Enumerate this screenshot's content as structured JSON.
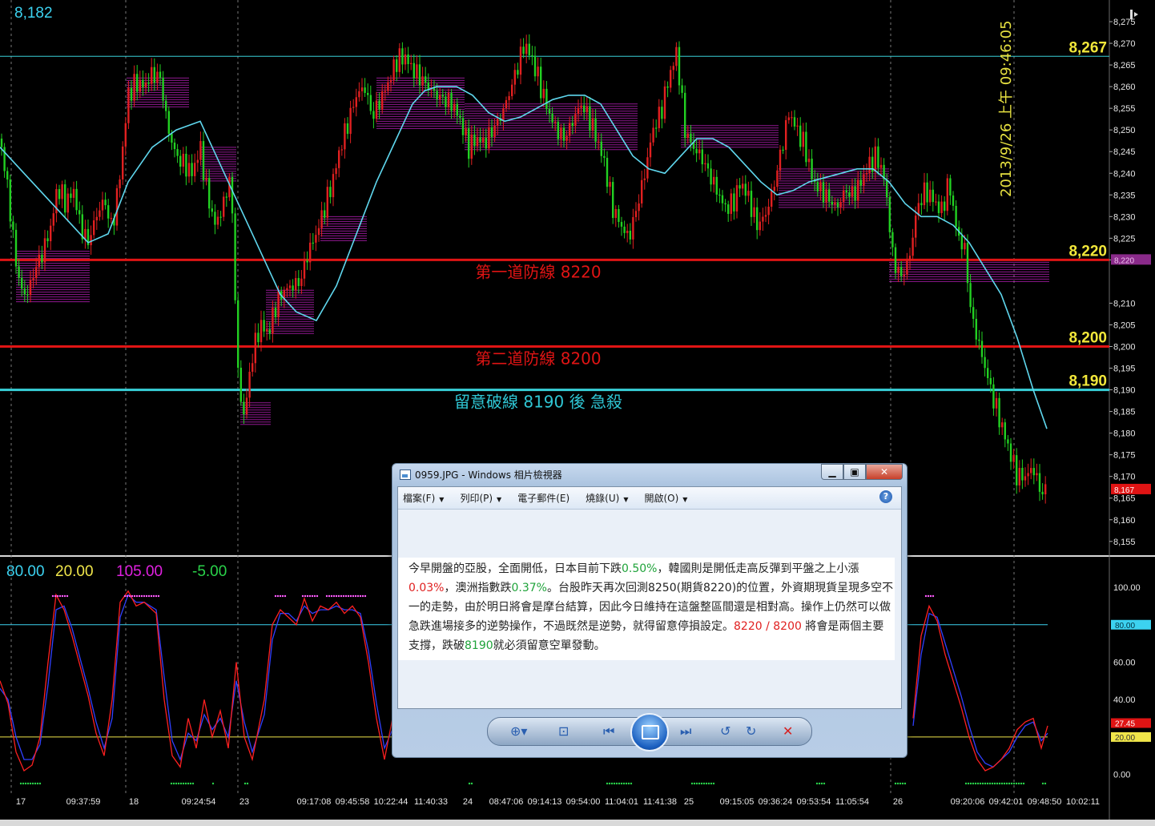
{
  "chart_data": {
    "type": "candlestick",
    "last_price_label": "8,182",
    "price_axis": {
      "ylim": [
        8152,
        8280
      ],
      "ticks": [
        "8,275",
        "8,270",
        "8,265",
        "8,260",
        "8,255",
        "8,250",
        "8,245",
        "8,240",
        "8,235",
        "8,230",
        "8,225",
        "8,220",
        "8,210",
        "8,205",
        "8,200",
        "8,195",
        "8,190",
        "8,185",
        "8,180",
        "8,175",
        "8,170",
        "8,165",
        "8,160",
        "8,155"
      ],
      "tick_values": [
        8275,
        8270,
        8265,
        8260,
        8255,
        8250,
        8245,
        8240,
        8235,
        8230,
        8225,
        8220,
        8210,
        8205,
        8200,
        8195,
        8190,
        8185,
        8180,
        8175,
        8170,
        8165,
        8160,
        8155
      ],
      "marker_8220": "8,220",
      "marker_current": "8,167",
      "marker_current_value": 8167
    },
    "timestamp_label": "2013/9/26 上午 09:46:05",
    "levels": [
      {
        "value": 8267,
        "label": "8,267",
        "color": "#38d0d8",
        "annotation": ""
      },
      {
        "value": 8220,
        "label": "8,220",
        "color": "#e01414",
        "annotation": "第一道防線 8220"
      },
      {
        "value": 8200,
        "label": "8,200",
        "color": "#e01414",
        "annotation": "第二道防線 8200"
      },
      {
        "value": 8190,
        "label": "8,190",
        "color": "#38d0d8",
        "annotation": "留意破線 8190 後 急殺"
      }
    ],
    "candle_colors": {
      "up": "#e02020",
      "down": "#22d022"
    },
    "ma_color": "#5fd7ee",
    "volume_profile_color": "#c020c0",
    "x_labels": [
      "17",
      "09:37:59",
      "18",
      "09:24:54",
      "23",
      "09:17:08",
      "09:45:58",
      "10:22:44",
      "11:40:33",
      "24",
      "08:47:06",
      "09:14:13",
      "09:54:00",
      "11:04:01",
      "11:41:38",
      "25",
      "09:15:05",
      "09:36:24",
      "09:53:54",
      "11:05:54",
      "26",
      "09:20:06",
      "09:42:01",
      "09:48:50",
      "10:02:11"
    ],
    "close_path": [
      [
        0,
        8248
      ],
      [
        10,
        8236
      ],
      [
        18,
        8222
      ],
      [
        26,
        8213
      ],
      [
        34,
        8212
      ],
      [
        44,
        8218
      ],
      [
        54,
        8222
      ],
      [
        64,
        8228
      ],
      [
        72,
        8237
      ],
      [
        82,
        8233
      ],
      [
        92,
        8236
      ],
      [
        100,
        8228
      ],
      [
        110,
        8224
      ],
      [
        120,
        8230
      ],
      [
        130,
        8234
      ],
      [
        140,
        8227
      ],
      [
        150,
        8240
      ],
      [
        160,
        8258
      ],
      [
        170,
        8261
      ],
      [
        180,
        8260
      ],
      [
        190,
        8263
      ],
      [
        200,
        8262
      ],
      [
        210,
        8250
      ],
      [
        220,
        8244
      ],
      [
        230,
        8242
      ],
      [
        240,
        8240
      ],
      [
        250,
        8246
      ],
      [
        258,
        8236
      ],
      [
        268,
        8228
      ],
      [
        278,
        8232
      ],
      [
        288,
        8240
      ],
      [
        298,
        8190
      ],
      [
        305,
        8184
      ],
      [
        315,
        8198
      ],
      [
        325,
        8205
      ],
      [
        335,
        8203
      ],
      [
        345,
        8210
      ],
      [
        355,
        8213
      ],
      [
        365,
        8214
      ],
      [
        375,
        8215
      ],
      [
        385,
        8222
      ],
      [
        395,
        8226
      ],
      [
        405,
        8232
      ],
      [
        415,
        8238
      ],
      [
        425,
        8246
      ],
      [
        435,
        8252
      ],
      [
        445,
        8258
      ],
      [
        455,
        8260
      ],
      [
        465,
        8253
      ],
      [
        475,
        8257
      ],
      [
        485,
        8261
      ],
      [
        495,
        8266
      ],
      [
        505,
        8267
      ],
      [
        515,
        8264
      ],
      [
        525,
        8262
      ],
      [
        535,
        8260
      ],
      [
        545,
        8258
      ],
      [
        555,
        8257
      ],
      [
        565,
        8256
      ],
      [
        575,
        8252
      ],
      [
        585,
        8246
      ],
      [
        595,
        8248
      ],
      [
        605,
        8247
      ],
      [
        615,
        8250
      ],
      [
        625,
        8253
      ],
      [
        635,
        8258
      ],
      [
        645,
        8264
      ],
      [
        655,
        8270
      ],
      [
        665,
        8266
      ],
      [
        675,
        8260
      ],
      [
        685,
        8254
      ],
      [
        695,
        8250
      ],
      [
        705,
        8248
      ],
      [
        715,
        8252
      ],
      [
        725,
        8256
      ],
      [
        735,
        8253
      ],
      [
        745,
        8248
      ],
      [
        755,
        8242
      ],
      [
        765,
        8232
      ],
      [
        775,
        8228
      ],
      [
        785,
        8225
      ],
      [
        795,
        8232
      ],
      [
        805,
        8240
      ],
      [
        815,
        8250
      ],
      [
        825,
        8254
      ],
      [
        835,
        8262
      ],
      [
        845,
        8268
      ],
      [
        855,
        8250
      ],
      [
        865,
        8246
      ],
      [
        875,
        8244
      ],
      [
        885,
        8240
      ],
      [
        895,
        8236
      ],
      [
        905,
        8232
      ],
      [
        915,
        8233
      ],
      [
        925,
        8238
      ],
      [
        935,
        8234
      ],
      [
        945,
        8228
      ],
      [
        955,
        8230
      ],
      [
        965,
        8236
      ],
      [
        975,
        8245
      ],
      [
        985,
        8254
      ],
      [
        995,
        8250
      ],
      [
        1005,
        8246
      ],
      [
        1015,
        8238
      ],
      [
        1025,
        8236
      ],
      [
        1035,
        8234
      ],
      [
        1045,
        8232
      ],
      [
        1055,
        8236
      ],
      [
        1065,
        8235
      ],
      [
        1075,
        8238
      ],
      [
        1085,
        8242
      ],
      [
        1095,
        8244
      ],
      [
        1105,
        8238
      ],
      [
        1115,
        8220
      ],
      [
        1125,
        8216
      ],
      [
        1135,
        8220
      ],
      [
        1145,
        8232
      ],
      [
        1155,
        8236
      ],
      [
        1165,
        8234
      ],
      [
        1175,
        8231
      ],
      [
        1185,
        8238
      ],
      [
        1195,
        8226
      ],
      [
        1205,
        8222
      ],
      [
        1212,
        8208
      ],
      [
        1220,
        8202
      ],
      [
        1230,
        8195
      ],
      [
        1240,
        8188
      ],
      [
        1250,
        8182
      ],
      [
        1260,
        8176
      ],
      [
        1270,
        8170
      ],
      [
        1280,
        8170
      ],
      [
        1290,
        8172
      ],
      [
        1300,
        8166
      ],
      [
        1306,
        8167
      ]
    ],
    "ma_path": [
      [
        0,
        8246
      ],
      [
        30,
        8240
      ],
      [
        60,
        8234
      ],
      [
        90,
        8228
      ],
      [
        110,
        8224
      ],
      [
        135,
        8226
      ],
      [
        160,
        8238
      ],
      [
        190,
        8246
      ],
      [
        220,
        8250
      ],
      [
        250,
        8252
      ],
      [
        270,
        8244
      ],
      [
        290,
        8236
      ],
      [
        310,
        8228
      ],
      [
        330,
        8220
      ],
      [
        350,
        8212
      ],
      [
        370,
        8208
      ],
      [
        395,
        8206
      ],
      [
        420,
        8214
      ],
      [
        445,
        8226
      ],
      [
        470,
        8238
      ],
      [
        495,
        8248
      ],
      [
        515,
        8256
      ],
      [
        530,
        8259
      ],
      [
        545,
        8260
      ],
      [
        570,
        8260
      ],
      [
        590,
        8258
      ],
      [
        610,
        8254
      ],
      [
        630,
        8252
      ],
      [
        650,
        8253
      ],
      [
        670,
        8255
      ],
      [
        690,
        8257
      ],
      [
        710,
        8258
      ],
      [
        730,
        8258
      ],
      [
        750,
        8256
      ],
      [
        770,
        8250
      ],
      [
        790,
        8244
      ],
      [
        810,
        8241
      ],
      [
        830,
        8240
      ],
      [
        850,
        8244
      ],
      [
        870,
        8248
      ],
      [
        890,
        8248
      ],
      [
        910,
        8246
      ],
      [
        930,
        8242
      ],
      [
        950,
        8238
      ],
      [
        970,
        8235
      ],
      [
        990,
        8236
      ],
      [
        1010,
        8238
      ],
      [
        1030,
        8239
      ],
      [
        1050,
        8240
      ],
      [
        1070,
        8241
      ],
      [
        1090,
        8241
      ],
      [
        1110,
        8238
      ],
      [
        1130,
        8233
      ],
      [
        1150,
        8230
      ],
      [
        1170,
        8230
      ],
      [
        1190,
        8228
      ],
      [
        1210,
        8224
      ],
      [
        1230,
        8218
      ],
      [
        1250,
        8212
      ],
      [
        1270,
        8202
      ],
      [
        1290,
        8190
      ],
      [
        1307,
        8181
      ]
    ],
    "volume_profile": [
      {
        "y0": 8210,
        "y1": 8222,
        "x0": 20,
        "x1": 112
      },
      {
        "y0": 8255,
        "y1": 8262,
        "x0": 158,
        "x1": 236
      },
      {
        "y0": 8238,
        "y1": 8246,
        "x0": 250,
        "x1": 295
      },
      {
        "y0": 8224,
        "y1": 8230,
        "x0": 400,
        "x1": 458
      },
      {
        "y0": 8203,
        "y1": 8213,
        "x0": 332,
        "x1": 392
      },
      {
        "y0": 8182,
        "y1": 8187,
        "x0": 300,
        "x1": 338
      },
      {
        "y0": 8250,
        "y1": 8262,
        "x0": 470,
        "x1": 580
      },
      {
        "y0": 8245,
        "y1": 8256,
        "x0": 580,
        "x1": 796
      },
      {
        "y0": 8246,
        "y1": 8251,
        "x0": 850,
        "x1": 972
      },
      {
        "y0": 8232,
        "y1": 8241,
        "x0": 972,
        "x1": 1110
      },
      {
        "y0": 8215,
        "y1": 8220,
        "x0": 1110,
        "x1": 1310
      }
    ],
    "oscillator": {
      "params": [
        "80.00",
        "20.00",
        "105.00",
        "-5.00"
      ],
      "param_colors": [
        "#3cd2f0",
        "#f0e64a",
        "#e020e0",
        "#2ad34a"
      ],
      "ylim": [
        -10,
        115
      ],
      "ticks": [
        "100.00",
        "80.00",
        "60.00",
        "40.00",
        "20.00",
        "0.00"
      ],
      "tick_values": [
        100,
        80,
        60,
        40,
        20,
        0
      ],
      "upper_level": 80,
      "lower_level": 20,
      "current_k": "27.45",
      "current_k_value": 27.45,
      "lower_tag": "20.00",
      "upper_tag": "80.00",
      "k_path": [
        [
          0,
          50
        ],
        [
          10,
          38
        ],
        [
          20,
          12
        ],
        [
          30,
          2
        ],
        [
          40,
          5
        ],
        [
          50,
          20
        ],
        [
          60,
          60
        ],
        [
          70,
          96
        ],
        [
          80,
          88
        ],
        [
          90,
          74
        ],
        [
          100,
          58
        ],
        [
          110,
          42
        ],
        [
          120,
          22
        ],
        [
          130,
          10
        ],
        [
          140,
          40
        ],
        [
          150,
          92
        ],
        [
          160,
          98
        ],
        [
          170,
          90
        ],
        [
          180,
          92
        ],
        [
          195,
          86
        ],
        [
          205,
          40
        ],
        [
          215,
          10
        ],
        [
          225,
          4
        ],
        [
          235,
          30
        ],
        [
          245,
          14
        ],
        [
          255,
          40
        ],
        [
          265,
          20
        ],
        [
          275,
          34
        ],
        [
          285,
          14
        ],
        [
          295,
          60
        ],
        [
          305,
          20
        ],
        [
          315,
          8
        ],
        [
          330,
          40
        ],
        [
          340,
          80
        ],
        [
          350,
          88
        ],
        [
          360,
          84
        ],
        [
          370,
          80
        ],
        [
          380,
          94
        ],
        [
          390,
          82
        ],
        [
          400,
          90
        ],
        [
          410,
          88
        ],
        [
          420,
          92
        ],
        [
          430,
          86
        ],
        [
          440,
          90
        ],
        [
          450,
          84
        ],
        [
          460,
          60
        ],
        [
          470,
          30
        ],
        [
          480,
          8
        ],
        [
          490,
          30
        ],
        [
          1140,
          30
        ],
        [
          1150,
          74
        ],
        [
          1160,
          90
        ],
        [
          1170,
          82
        ],
        [
          1180,
          64
        ],
        [
          1190,
          50
        ],
        [
          1200,
          36
        ],
        [
          1210,
          20
        ],
        [
          1220,
          8
        ],
        [
          1230,
          2
        ],
        [
          1240,
          4
        ],
        [
          1250,
          8
        ],
        [
          1260,
          14
        ],
        [
          1270,
          24
        ],
        [
          1280,
          28
        ],
        [
          1290,
          30
        ],
        [
          1300,
          14
        ],
        [
          1308,
          26
        ]
      ],
      "d_path": [
        [
          0,
          46
        ],
        [
          10,
          40
        ],
        [
          20,
          20
        ],
        [
          30,
          8
        ],
        [
          40,
          8
        ],
        [
          50,
          16
        ],
        [
          60,
          48
        ],
        [
          70,
          88
        ],
        [
          80,
          90
        ],
        [
          90,
          78
        ],
        [
          100,
          62
        ],
        [
          110,
          46
        ],
        [
          120,
          28
        ],
        [
          130,
          14
        ],
        [
          140,
          30
        ],
        [
          150,
          84
        ],
        [
          160,
          96
        ],
        [
          170,
          92
        ],
        [
          180,
          92
        ],
        [
          195,
          88
        ],
        [
          205,
          52
        ],
        [
          215,
          18
        ],
        [
          225,
          8
        ],
        [
          235,
          22
        ],
        [
          245,
          18
        ],
        [
          255,
          32
        ],
        [
          265,
          24
        ],
        [
          275,
          30
        ],
        [
          285,
          20
        ],
        [
          295,
          50
        ],
        [
          305,
          28
        ],
        [
          315,
          12
        ],
        [
          330,
          32
        ],
        [
          340,
          72
        ],
        [
          350,
          86
        ],
        [
          360,
          86
        ],
        [
          370,
          82
        ],
        [
          380,
          90
        ],
        [
          390,
          86
        ],
        [
          400,
          88
        ],
        [
          410,
          88
        ],
        [
          420,
          90
        ],
        [
          430,
          88
        ],
        [
          440,
          88
        ],
        [
          450,
          86
        ],
        [
          460,
          66
        ],
        [
          470,
          38
        ],
        [
          480,
          14
        ],
        [
          490,
          24
        ],
        [
          1140,
          26
        ],
        [
          1150,
          64
        ],
        [
          1160,
          86
        ],
        [
          1170,
          84
        ],
        [
          1180,
          70
        ],
        [
          1190,
          56
        ],
        [
          1200,
          42
        ],
        [
          1210,
          26
        ],
        [
          1220,
          12
        ],
        [
          1230,
          6
        ],
        [
          1240,
          4
        ],
        [
          1250,
          8
        ],
        [
          1260,
          12
        ],
        [
          1270,
          20
        ],
        [
          1280,
          26
        ],
        [
          1290,
          28
        ],
        [
          1300,
          18
        ],
        [
          1308,
          22
        ]
      ]
    }
  },
  "viewer": {
    "title": "0959.JPG - Windows 相片檢視器",
    "menu": [
      "檔案(F)",
      "列印(P)",
      "電子郵件(E)",
      "燒錄(U)",
      "開啟(O)"
    ],
    "help": "?",
    "article": {
      "t1": "今早開盤的亞股，全面開低，日本目前下跌",
      "v1": "0.50%",
      "t2": "，韓國則是開低走高反彈到平盤之上小漲",
      "v2": "0.03%",
      "t3": "，澳洲指數跌",
      "v3": "0.37%",
      "t4": "。台股昨天再次回測8250(期貨8220)的位置，外資期現貨呈現多空不一的走勢，由於明日將會是摩台結算，因此今日維持在這盤整區間還是相對高。操作上仍然可以做急跌進場接多的逆勢操作，不過既然是逆勢，就得留意停損設定。",
      "v4": "8220",
      "t5": " / ",
      "v5": "8200",
      "t6": " 將會是兩個主要支撐，跌破",
      "v6": "8190",
      "t7": "就必須留意空單發動。"
    }
  }
}
